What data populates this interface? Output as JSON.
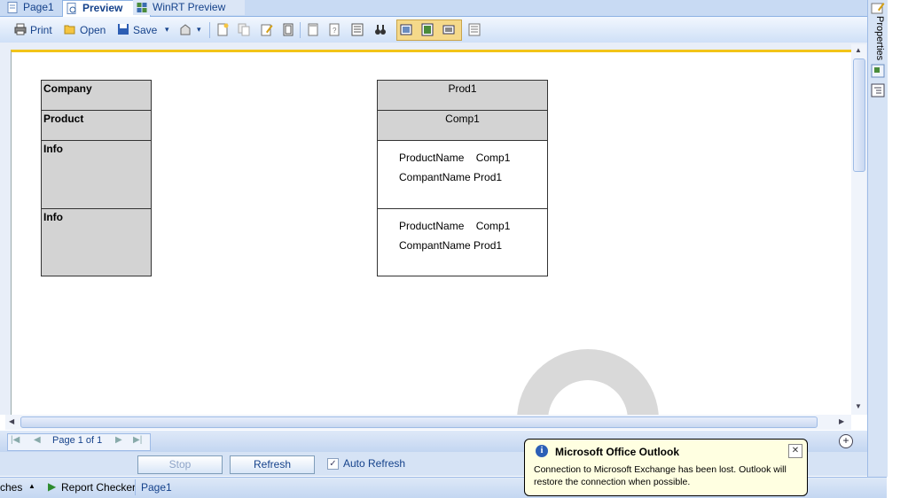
{
  "tabs": [
    {
      "label": "Page1"
    },
    {
      "label": "Preview"
    },
    {
      "label": "WinRT Preview"
    }
  ],
  "toolbar": {
    "print_label": "Print",
    "open_label": "Open",
    "save_label": "Save"
  },
  "report": {
    "left_labels": [
      "Company",
      "Product",
      "Info",
      "Info"
    ],
    "right_header": [
      "Prod1",
      "Comp1"
    ],
    "info_rows": [
      {
        "name": "ProductName",
        "value": "Comp1"
      },
      {
        "name": "CompantName",
        "value": "Prod1"
      }
    ]
  },
  "nav": {
    "page_text": "Page 1 of 1"
  },
  "buttons": {
    "stop_label": "Stop",
    "refresh_label": "Refresh",
    "auto_refresh_label": "Auto Refresh",
    "auto_refresh_checked": true
  },
  "statusbar": {
    "left_text": "ches",
    "report_checker_label": "Report Checker",
    "page_label": "Page1"
  },
  "side_panel": {
    "properties_label": "Properties"
  },
  "notification": {
    "title": "Microsoft Office Outlook",
    "message_line1": "Connection to Microsoft Exchange has been lost. Outlook will",
    "message_line2": "restore the connection when possible."
  }
}
